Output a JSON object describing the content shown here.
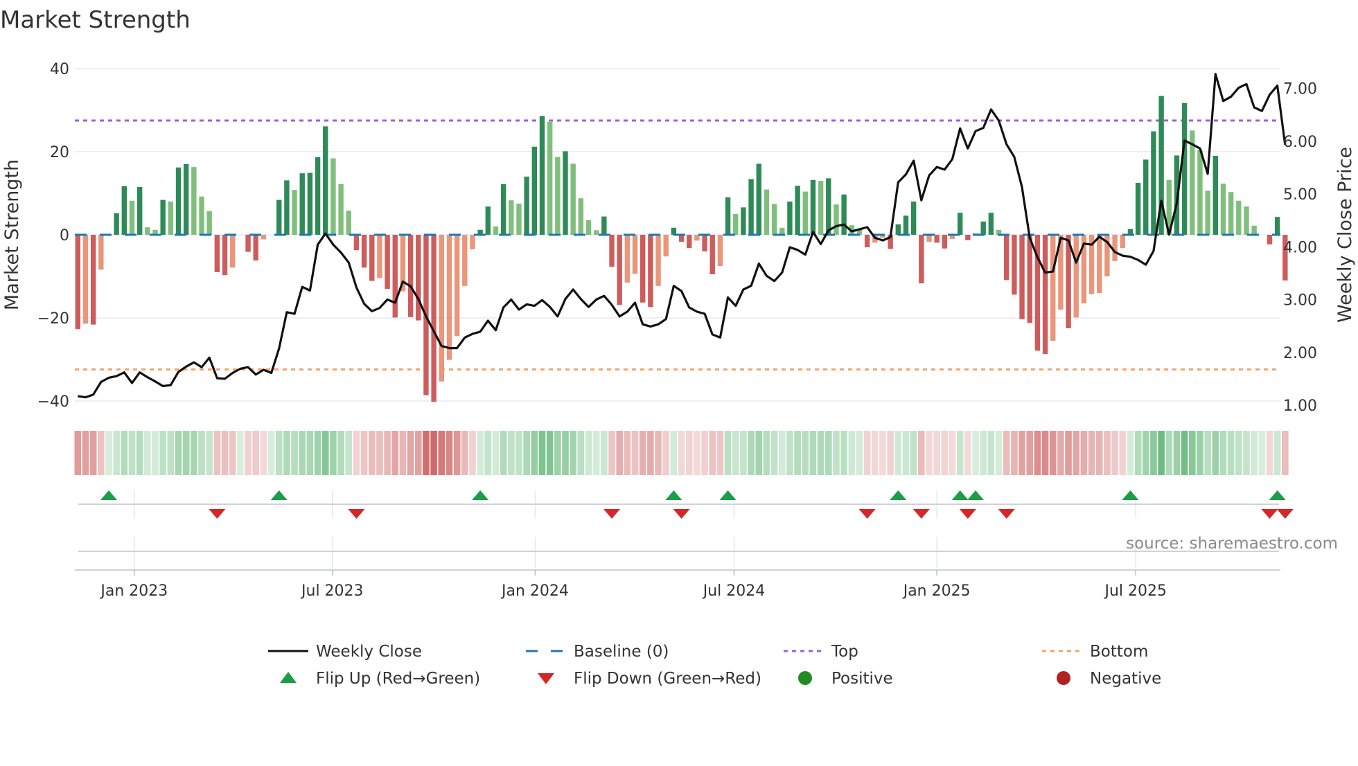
{
  "title": "Market Strength",
  "source": "source: sharemaestro.com",
  "chart_data": {
    "type": "bar",
    "title": "Market Strength",
    "ylabel": "Market Strength",
    "y2label": "Weekly Close Price",
    "ylim": [
      -42,
      42
    ],
    "y2lim": [
      1.0,
      7.4
    ],
    "yticks": [
      {
        "v": 40,
        "label": "40"
      },
      {
        "v": 20,
        "label": "20"
      },
      {
        "v": 0,
        "label": "0"
      },
      {
        "v": -20,
        "label": "−20"
      },
      {
        "v": -40,
        "label": "−40"
      }
    ],
    "y2ticks": [
      {
        "v": 7,
        "label": "7.00"
      },
      {
        "v": 6,
        "label": "6.00"
      },
      {
        "v": 5,
        "label": "5.00"
      },
      {
        "v": 4,
        "label": "4.00"
      },
      {
        "v": 3,
        "label": "3.00"
      },
      {
        "v": 2,
        "label": "2.00"
      },
      {
        "v": 1,
        "label": "1.00"
      }
    ],
    "x_unit": "week index (1 = first bar)",
    "xticks": [
      {
        "week": 8.3,
        "label": "Jan 2023"
      },
      {
        "week": 33.9,
        "label": "Jul 2023"
      },
      {
        "week": 60.1,
        "label": "Jan 2024"
      },
      {
        "week": 85.8,
        "label": "Jul 2024"
      },
      {
        "week": 112.0,
        "label": "Jan 2025"
      },
      {
        "week": 137.7,
        "label": "Jul 2025"
      }
    ],
    "top_level": 27.5,
    "bottom_level": -32.4,
    "baseline": 0,
    "strength": [
      -22.7,
      -21.4,
      -21.6,
      -8.4,
      0,
      5.2,
      11.7,
      8.2,
      11.5,
      1.8,
      1.2,
      8.4,
      8.0,
      16.2,
      17.0,
      16.3,
      9.2,
      5.7,
      -9.0,
      -9.7,
      -7.9,
      0,
      -4.1,
      -6.2,
      -1.1,
      0,
      8.4,
      13.1,
      10.8,
      14.8,
      14.9,
      18.7,
      26.1,
      18.4,
      12.2,
      5.8,
      -3.7,
      -7.9,
      -11.1,
      -10.4,
      -13.0,
      -19.9,
      -13.6,
      -19.8,
      -20.6,
      -38.6,
      -40.2,
      -35.3,
      -30.1,
      -24.4,
      -12.3,
      -3.5,
      1.2,
      6.8,
      2.0,
      12.2,
      8.3,
      7.5,
      14.0,
      21.2,
      28.6,
      27.2,
      18.7,
      20.1,
      17.1,
      8.8,
      3.5,
      1.1,
      4.4,
      -7.7,
      -16.9,
      -11.5,
      -9.4,
      -16.3,
      -17.4,
      -12.3,
      -5.2,
      1.7,
      -1.7,
      -3.2,
      -1.4,
      -4.0,
      -9.5,
      -7.5,
      9.0,
      5.0,
      6.6,
      13.4,
      17.1,
      10.9,
      7.4,
      1.7,
      8.0,
      11.8,
      10.4,
      13.2,
      13.0,
      13.6,
      7.3,
      9.7,
      2.3,
      1.2,
      -3.0,
      -1.9,
      -0.7,
      -3.4,
      2.5,
      4.6,
      8.0,
      -11.7,
      -1.7,
      -1.9,
      -3.3,
      -1.0,
      5.3,
      -1.3,
      0.3,
      3.2,
      5.3,
      1.2,
      -10.9,
      -14.4,
      -20.3,
      -21.2,
      -27.9,
      -28.7,
      -25.5,
      -18.0,
      -22.5,
      -19.9,
      -16.5,
      -14.3,
      -14.0,
      -10.0,
      -6.3,
      -3.2,
      1.4,
      12.5,
      18.1,
      24.9,
      33.4,
      13.2,
      19.1,
      31.7,
      25.1,
      20.4,
      10.6,
      19.0,
      12.3,
      10.3,
      8.2,
      6.8,
      2.2,
      0,
      -2.3,
      4.3,
      -11.0
    ],
    "weekly_close": [
      1.17,
      1.15,
      1.2,
      1.44,
      1.52,
      1.55,
      1.62,
      1.42,
      1.62,
      1.53,
      1.45,
      1.36,
      1.38,
      1.63,
      1.73,
      1.81,
      1.72,
      1.9,
      1.51,
      1.5,
      1.61,
      1.69,
      1.72,
      1.58,
      1.67,
      1.61,
      2.07,
      2.76,
      2.73,
      3.24,
      3.17,
      4.04,
      4.25,
      4.04,
      3.89,
      3.7,
      3.23,
      2.92,
      2.78,
      2.84,
      3.0,
      2.94,
      3.34,
      3.25,
      3.01,
      2.68,
      2.4,
      2.12,
      2.08,
      2.08,
      2.28,
      2.35,
      2.39,
      2.6,
      2.42,
      2.85,
      3.0,
      2.81,
      2.91,
      2.88,
      2.99,
      2.86,
      2.68,
      3.01,
      3.19,
      3.01,
      2.86,
      3.0,
      3.07,
      2.9,
      2.68,
      2.77,
      2.94,
      2.53,
      2.49,
      2.53,
      2.63,
      3.26,
      3.16,
      2.85,
      2.77,
      2.73,
      2.34,
      2.28,
      3.04,
      2.88,
      3.19,
      3.26,
      3.68,
      3.45,
      3.35,
      3.51,
      3.99,
      3.94,
      3.85,
      4.28,
      4.05,
      4.31,
      4.39,
      4.42,
      4.29,
      4.33,
      4.37,
      4.17,
      4.12,
      4.18,
      5.22,
      5.37,
      5.63,
      4.88,
      5.35,
      5.51,
      5.46,
      5.66,
      6.24,
      5.86,
      6.19,
      6.25,
      6.6,
      6.39,
      5.94,
      5.7,
      5.13,
      4.17,
      3.8,
      3.51,
      3.53,
      4.17,
      4.12,
      3.7,
      4.06,
      4.04,
      4.19,
      4.09,
      3.9,
      3.83,
      3.81,
      3.75,
      3.66,
      3.92,
      4.87,
      4.23,
      4.82,
      6.01,
      5.94,
      5.86,
      5.38,
      7.27,
      6.76,
      6.84,
      7.01,
      7.08,
      6.64,
      6.57,
      6.88,
      7.05,
      5.93
    ],
    "flip_up_weeks": [
      5,
      27,
      53,
      78,
      85,
      107,
      115,
      117,
      137,
      156
    ],
    "flip_down_weeks": [
      19,
      37,
      70,
      79,
      103,
      110,
      116,
      121,
      155,
      157
    ],
    "legend": {
      "placement": "bottom",
      "items": [
        {
          "key": "close",
          "label": "Weekly Close"
        },
        {
          "key": "baseline",
          "label": "Baseline (0)"
        },
        {
          "key": "top",
          "label": "Top"
        },
        {
          "key": "bottom",
          "label": "Bottom"
        },
        {
          "key": "flipup",
          "label": "Flip Up (Red→Green)"
        },
        {
          "key": "flipdown",
          "label": "Flip Down (Green→Red)"
        },
        {
          "key": "positive",
          "label": "Positive"
        },
        {
          "key": "negative",
          "label": "Negative"
        }
      ]
    },
    "colors": {
      "pos_strong": "#2e8b57",
      "pos_weak": "#7fbf7b",
      "neg_strong": "#cd5c5c",
      "neg_weak": "#e9967a",
      "baseline": "#1f77b4",
      "top": "#9b5fe0",
      "bottom": "#f4a460",
      "close": "#111111",
      "flip_up": "#1a9e48",
      "flip_down": "#d62728",
      "positive": "#228b22",
      "negative": "#b22222"
    }
  }
}
